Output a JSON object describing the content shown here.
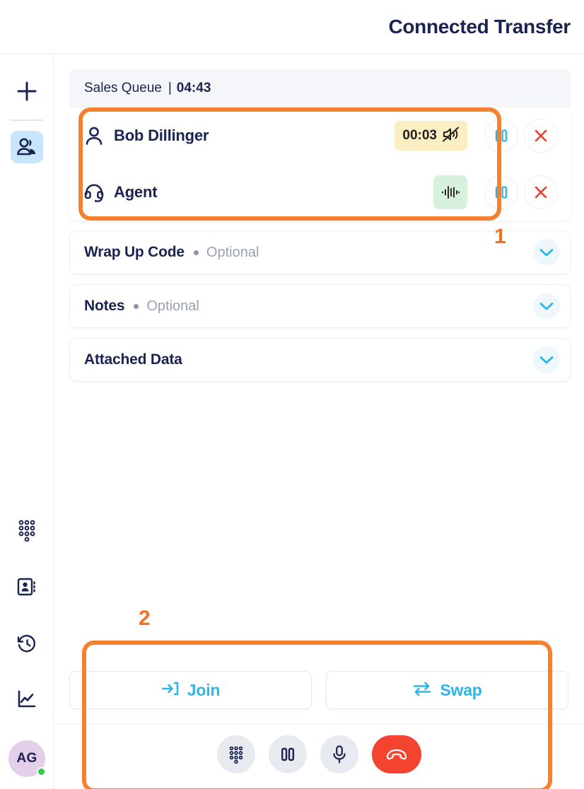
{
  "header": {
    "title": "Connected Transfer"
  },
  "sidebar": {
    "add_label": "plus-icon",
    "items": [
      {
        "name": "contacts-teams",
        "icon": "people-icon",
        "active": true
      }
    ],
    "bottom_items": [
      {
        "name": "dialpad",
        "icon": "dialpad-icon"
      },
      {
        "name": "contacts",
        "icon": "contact-book-icon"
      },
      {
        "name": "history",
        "icon": "history-clock-icon"
      },
      {
        "name": "analytics",
        "icon": "line-chart-icon"
      }
    ],
    "avatar": {
      "initials": "AG",
      "status": "online",
      "status_color": "#35c74a",
      "bg_color": "#e4cfeb"
    }
  },
  "queue": {
    "name": "Sales Queue",
    "separator": "|",
    "timer": "04:43"
  },
  "call_rows": [
    {
      "name": "Bob Dillinger",
      "icon": "person-icon",
      "badge_type": "hold-timer",
      "badge_text": "00:03",
      "badge_icon": "speaker-muted-icon",
      "badge_color": "#fbeec2",
      "pause_label": "pause-icon",
      "end_label": "close-icon"
    },
    {
      "name": "Agent",
      "icon": "headset-icon",
      "badge_type": "waveform",
      "badge_text": "",
      "badge_icon": "waveform-icon",
      "badge_color": "#d8f0de",
      "pause_label": "pause-icon",
      "end_label": "close-icon"
    }
  ],
  "sections": [
    {
      "title": "Wrap Up Code",
      "optional": "Optional",
      "has_dot": true
    },
    {
      "title": "Notes",
      "optional": "Optional",
      "has_dot": true
    },
    {
      "title": "Attached Data",
      "optional": "",
      "has_dot": false
    }
  ],
  "transfer_actions": [
    {
      "label": "Join",
      "icon": "join-arrow-icon"
    },
    {
      "label": "Swap",
      "icon": "swap-arrows-icon"
    }
  ],
  "call_controls": [
    {
      "name": "dialpad",
      "icon": "dialpad-icon"
    },
    {
      "name": "hold",
      "icon": "pause-icon"
    },
    {
      "name": "mute",
      "icon": "microphone-icon"
    },
    {
      "name": "hangup",
      "icon": "phone-hangup-icon",
      "color": "#f4432e"
    }
  ],
  "annotations": [
    {
      "number": "1"
    },
    {
      "number": "2"
    }
  ],
  "colors": {
    "accent_cyan": "#2ab6ea",
    "navy": "#1b2450",
    "annotation_orange": "#f5802f",
    "danger_red": "#f4432e"
  }
}
